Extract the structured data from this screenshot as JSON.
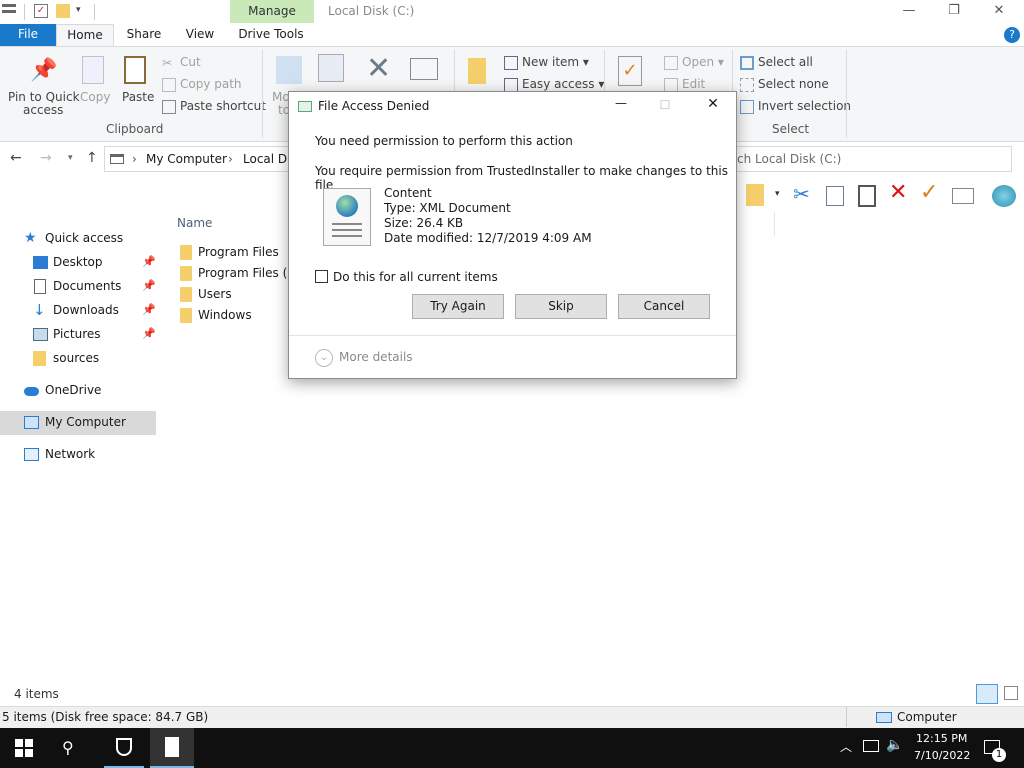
{
  "titlebar": {
    "manage_tab": "Manage",
    "window_title": "Local Disk (C:)",
    "minimize": "—",
    "maximize": "❐",
    "close": "✕"
  },
  "ribbon_tabs": {
    "file": "File",
    "home": "Home",
    "share": "Share",
    "view": "View",
    "drive_tools": "Drive Tools"
  },
  "ribbon": {
    "pin_line1": "Pin to Quick",
    "pin_line2": "access",
    "copy": "Copy",
    "paste": "Paste",
    "cut": "Cut",
    "copy_path": "Copy path",
    "paste_shortcut": "Paste shortcut",
    "clipboard_group": "Clipboard",
    "move_to": "Mo",
    "move_to2": "to",
    "new_item": "New item",
    "easy_access": "Easy access",
    "open": "Open",
    "edit": "Edit",
    "select_all": "Select all",
    "select_none": "Select none",
    "invert_selection": "Invert selection",
    "select_group": "Select"
  },
  "address": {
    "segments": [
      "My Computer",
      "Local Disk"
    ],
    "search_placeholder": "ch Local Disk (C:)"
  },
  "nav": {
    "quick_access": "Quick access",
    "desktop": "Desktop",
    "documents": "Documents",
    "downloads": "Downloads",
    "pictures": "Pictures",
    "sources": "sources",
    "onedrive": "OneDrive",
    "my_computer": "My Computer",
    "network": "Network"
  },
  "files": {
    "name_header": "Name",
    "items": [
      "Program Files",
      "Program Files (x8",
      "Users",
      "Windows"
    ]
  },
  "status": {
    "item_count": "4 items",
    "free_space": "5 items (Disk free space: 84.7 GB)",
    "computer": "Computer"
  },
  "taskbar": {
    "time": "12:15 PM",
    "date": "7/10/2022",
    "notification_count": "1"
  },
  "dialog": {
    "title": "File Access Denied",
    "message1": "You need permission to perform this action",
    "message2": "You require permission from TrustedInstaller to make changes to this file",
    "file_name": "Content",
    "file_type": "Type: XML Document",
    "file_size": "Size: 26.4 KB",
    "file_date": "Date modified: 12/7/2019 4:09 AM",
    "checkbox_label": "Do this for all current items",
    "try_again": "Try Again",
    "skip": "Skip",
    "cancel": "Cancel",
    "more_details": "More details"
  },
  "colors": {
    "file_tab": "#1979ca",
    "manage_tab": "#c9eab8",
    "folder": "#f4cf6b",
    "taskbar": "#101010"
  }
}
